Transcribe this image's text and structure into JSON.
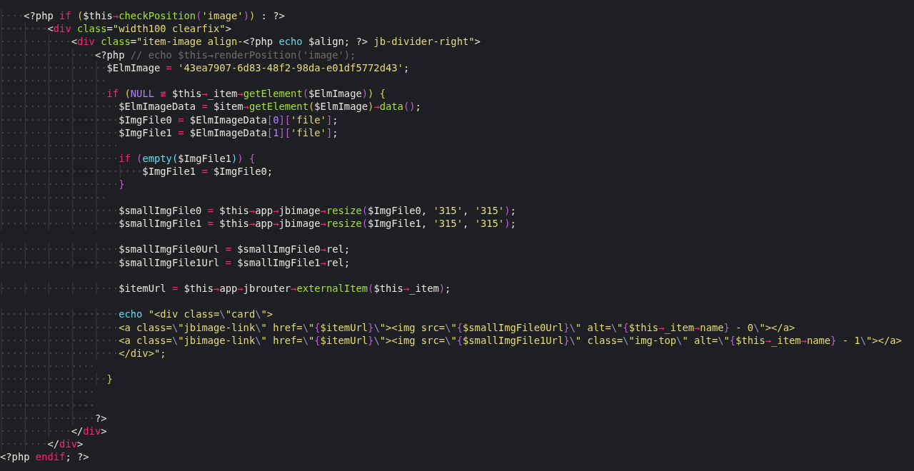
{
  "editor": {
    "lines": [
      {
        "indent": "····",
        "tokens": [
          {
            "kind": "plain",
            "text": "<?php "
          },
          {
            "kind": "kw",
            "text": "if "
          },
          {
            "kind": "b1",
            "text": "("
          },
          {
            "kind": "plain",
            "text": "$this"
          },
          {
            "kind": "kw",
            "text": "→"
          },
          {
            "kind": "fn",
            "text": "checkPosition"
          },
          {
            "kind": "b2",
            "text": "("
          },
          {
            "kind": "str",
            "text": "'image'"
          },
          {
            "kind": "b2",
            "text": ")"
          },
          {
            "kind": "b1",
            "text": ")"
          },
          {
            "kind": "plain",
            "text": " : ?>"
          }
        ]
      },
      {
        "indent": "········",
        "tokens": [
          {
            "kind": "plain",
            "text": "<"
          },
          {
            "kind": "kw",
            "text": "div"
          },
          {
            "kind": "fn",
            "text": " class"
          },
          {
            "kind": "plain",
            "text": "="
          },
          {
            "kind": "str",
            "text": "\"width100 clearfix\""
          },
          {
            "kind": "plain",
            "text": ">"
          }
        ]
      },
      {
        "indent": "············",
        "tokens": [
          {
            "kind": "plain",
            "text": "<"
          },
          {
            "kind": "kw",
            "text": "div"
          },
          {
            "kind": "fn",
            "text": " class"
          },
          {
            "kind": "plain",
            "text": "="
          },
          {
            "kind": "str",
            "text": "\"item-image align-"
          },
          {
            "kind": "plain",
            "text": "<?php "
          },
          {
            "kind": "builtin",
            "text": "echo"
          },
          {
            "kind": "plain",
            "text": " $align; ?>"
          },
          {
            "kind": "str",
            "text": " jb-divider-right\""
          },
          {
            "kind": "plain",
            "text": ">"
          }
        ]
      },
      {
        "indent": "················",
        "tokens": [
          {
            "kind": "plain",
            "text": "<?php "
          },
          {
            "kind": "comment",
            "text": "// echo $this→renderPosition('image');"
          }
        ]
      },
      {
        "indent": "··················",
        "tokens": [
          {
            "kind": "plain",
            "text": "$ElmImage"
          },
          {
            "kind": "kw",
            "text": " = "
          },
          {
            "kind": "str",
            "text": "'43ea7907-6d83-48f2-98da-e01df5772d43'"
          },
          {
            "kind": "plain",
            "text": ";"
          }
        ]
      },
      {
        "indent": "··················"
      },
      {
        "indent": "··················",
        "tokens": [
          {
            "kind": "kw",
            "text": "if "
          },
          {
            "kind": "b1",
            "text": "("
          },
          {
            "kind": "num",
            "text": "NULL"
          },
          {
            "kind": "kw",
            "text": " ≢ "
          },
          {
            "kind": "plain",
            "text": "$this"
          },
          {
            "kind": "kw",
            "text": "→"
          },
          {
            "kind": "plain",
            "text": "_item"
          },
          {
            "kind": "kw",
            "text": "→"
          },
          {
            "kind": "fn",
            "text": "getElement"
          },
          {
            "kind": "b2",
            "text": "("
          },
          {
            "kind": "plain",
            "text": "$ElmImage"
          },
          {
            "kind": "b2",
            "text": ")"
          },
          {
            "kind": "b1",
            "text": ") {"
          }
        ]
      },
      {
        "indent": "····················",
        "tokens": [
          {
            "kind": "plain",
            "text": "$ElmImageData"
          },
          {
            "kind": "kw",
            "text": " = "
          },
          {
            "kind": "plain",
            "text": "$item"
          },
          {
            "kind": "kw",
            "text": "→"
          },
          {
            "kind": "fn",
            "text": "getElement"
          },
          {
            "kind": "b1",
            "text": "("
          },
          {
            "kind": "plain",
            "text": "$ElmImage"
          },
          {
            "kind": "b1",
            "text": ")"
          },
          {
            "kind": "kw",
            "text": "→"
          },
          {
            "kind": "fn",
            "text": "data"
          },
          {
            "kind": "b2",
            "text": "()"
          },
          {
            "kind": "plain",
            "text": ";"
          }
        ]
      },
      {
        "indent": "····················",
        "tokens": [
          {
            "kind": "plain",
            "text": "$ImgFile0"
          },
          {
            "kind": "kw",
            "text": " = "
          },
          {
            "kind": "plain",
            "text": "$ElmImageData"
          },
          {
            "kind": "b2",
            "text": "["
          },
          {
            "kind": "num",
            "text": "0"
          },
          {
            "kind": "b2",
            "text": "]["
          },
          {
            "kind": "str",
            "text": "'file'"
          },
          {
            "kind": "b2",
            "text": "]"
          },
          {
            "kind": "plain",
            "text": ";"
          }
        ]
      },
      {
        "indent": "····················",
        "tokens": [
          {
            "kind": "plain",
            "text": "$ImgFile1"
          },
          {
            "kind": "kw",
            "text": " = "
          },
          {
            "kind": "plain",
            "text": "$ElmImageData"
          },
          {
            "kind": "b2",
            "text": "["
          },
          {
            "kind": "num",
            "text": "1"
          },
          {
            "kind": "b2",
            "text": "]["
          },
          {
            "kind": "str",
            "text": "'file'"
          },
          {
            "kind": "b2",
            "text": "]"
          },
          {
            "kind": "plain",
            "text": ";"
          }
        ]
      },
      {
        "indent": "····················"
      },
      {
        "indent": "····················",
        "tokens": [
          {
            "kind": "kw",
            "text": "if "
          },
          {
            "kind": "b2",
            "text": "("
          },
          {
            "kind": "builtin",
            "text": "empty"
          },
          {
            "kind": "builtin",
            "text": "("
          },
          {
            "kind": "plain",
            "text": "$ImgFile1"
          },
          {
            "kind": "builtin",
            "text": ")"
          },
          {
            "kind": "b2",
            "text": ") {"
          }
        ]
      },
      {
        "indent": "························",
        "tokens": [
          {
            "kind": "plain",
            "text": "$ImgFile1"
          },
          {
            "kind": "kw",
            "text": " = "
          },
          {
            "kind": "plain",
            "text": "$ImgFile0;"
          }
        ]
      },
      {
        "indent": "····················",
        "tokens": [
          {
            "kind": "b2",
            "text": "}"
          }
        ]
      },
      {
        "indent": "··················"
      },
      {
        "indent": "····················",
        "tokens": [
          {
            "kind": "plain",
            "text": "$smallImgFile0"
          },
          {
            "kind": "kw",
            "text": " = "
          },
          {
            "kind": "plain",
            "text": "$this"
          },
          {
            "kind": "kw",
            "text": "→"
          },
          {
            "kind": "plain",
            "text": "app"
          },
          {
            "kind": "kw",
            "text": "→"
          },
          {
            "kind": "plain",
            "text": "jbimage"
          },
          {
            "kind": "kw",
            "text": "→"
          },
          {
            "kind": "fn",
            "text": "resize"
          },
          {
            "kind": "b2",
            "text": "("
          },
          {
            "kind": "plain",
            "text": "$ImgFile0, "
          },
          {
            "kind": "str",
            "text": "'315'"
          },
          {
            "kind": "plain",
            "text": ", "
          },
          {
            "kind": "str",
            "text": "'315'"
          },
          {
            "kind": "b2",
            "text": ")"
          },
          {
            "kind": "plain",
            "text": ";"
          }
        ]
      },
      {
        "indent": "····················",
        "tokens": [
          {
            "kind": "plain",
            "text": "$smallImgFile1"
          },
          {
            "kind": "kw",
            "text": " = "
          },
          {
            "kind": "plain",
            "text": "$this"
          },
          {
            "kind": "kw",
            "text": "→"
          },
          {
            "kind": "plain",
            "text": "app"
          },
          {
            "kind": "kw",
            "text": "→"
          },
          {
            "kind": "plain",
            "text": "jbimage"
          },
          {
            "kind": "kw",
            "text": "→"
          },
          {
            "kind": "fn",
            "text": "resize"
          },
          {
            "kind": "b2",
            "text": "("
          },
          {
            "kind": "plain",
            "text": "$ImgFile1, "
          },
          {
            "kind": "str",
            "text": "'315'"
          },
          {
            "kind": "plain",
            "text": ", "
          },
          {
            "kind": "str",
            "text": "'315'"
          },
          {
            "kind": "b2",
            "text": ")"
          },
          {
            "kind": "plain",
            "text": ";"
          }
        ]
      },
      {
        "space_before": true,
        "indent": "····················",
        "tokens": [
          {
            "kind": "plain",
            "text": "$smallImgFile0Url"
          },
          {
            "kind": "kw",
            "text": " = "
          },
          {
            "kind": "plain",
            "text": "$smallImgFile0"
          },
          {
            "kind": "kw",
            "text": "→"
          },
          {
            "kind": "plain",
            "text": "rel;"
          }
        ]
      },
      {
        "indent": "····················",
        "tokens": [
          {
            "kind": "plain",
            "text": "$smallImgFile1Url"
          },
          {
            "kind": "kw",
            "text": " = "
          },
          {
            "kind": "plain",
            "text": "$smallImgFile1"
          },
          {
            "kind": "kw",
            "text": "→"
          },
          {
            "kind": "plain",
            "text": "rel;"
          }
        ]
      },
      {
        "space_before": true,
        "indent": "····················",
        "tokens": [
          {
            "kind": "plain",
            "text": "$itemUrl"
          },
          {
            "kind": "kw",
            "text": " = "
          },
          {
            "kind": "plain",
            "text": "$this"
          },
          {
            "kind": "kw",
            "text": "→"
          },
          {
            "kind": "plain",
            "text": "app"
          },
          {
            "kind": "kw",
            "text": "→"
          },
          {
            "kind": "plain",
            "text": "jbrouter"
          },
          {
            "kind": "kw",
            "text": "→"
          },
          {
            "kind": "fn",
            "text": "externalItem"
          },
          {
            "kind": "b2",
            "text": "("
          },
          {
            "kind": "plain",
            "text": "$this"
          },
          {
            "kind": "kw",
            "text": "→"
          },
          {
            "kind": "plain",
            "text": "_item"
          },
          {
            "kind": "b2",
            "text": ")"
          },
          {
            "kind": "plain",
            "text": ";"
          }
        ]
      },
      {
        "space_before": true,
        "indent": "····················",
        "tokens": [
          {
            "kind": "builtin",
            "text": "echo"
          },
          {
            "kind": "str",
            "text": " \"<div class="
          },
          {
            "kind": "esc",
            "text": "\\"
          },
          {
            "kind": "str",
            "text": "\"card"
          },
          {
            "kind": "esc",
            "text": "\\"
          },
          {
            "kind": "str",
            "text": "\">"
          }
        ]
      },
      {
        "indent": "····················",
        "tokens": [
          {
            "kind": "str",
            "text": "<a class="
          },
          {
            "kind": "esc",
            "text": "\\"
          },
          {
            "kind": "str",
            "text": "\"jbimage-link"
          },
          {
            "kind": "esc",
            "text": "\\"
          },
          {
            "kind": "str",
            "text": "\" href="
          },
          {
            "kind": "esc",
            "text": "\\"
          },
          {
            "kind": "str",
            "text": "\""
          },
          {
            "kind": "b2",
            "text": "{"
          },
          {
            "kind": "str",
            "text": "$itemUrl"
          },
          {
            "kind": "b2",
            "text": "}"
          },
          {
            "kind": "esc",
            "text": "\\"
          },
          {
            "kind": "str",
            "text": "\"><img src="
          },
          {
            "kind": "esc",
            "text": "\\"
          },
          {
            "kind": "str",
            "text": "\""
          },
          {
            "kind": "b2",
            "text": "{"
          },
          {
            "kind": "str",
            "text": "$smallImgFile0Url"
          },
          {
            "kind": "b2",
            "text": "}"
          },
          {
            "kind": "esc",
            "text": "\\"
          },
          {
            "kind": "str",
            "text": "\" alt="
          },
          {
            "kind": "esc",
            "text": "\\"
          },
          {
            "kind": "str",
            "text": "\""
          },
          {
            "kind": "b2",
            "text": "{"
          },
          {
            "kind": "str",
            "text": "$this"
          },
          {
            "kind": "kw",
            "text": "→"
          },
          {
            "kind": "str",
            "text": "_item"
          },
          {
            "kind": "kw",
            "text": "→"
          },
          {
            "kind": "str",
            "text": "name"
          },
          {
            "kind": "b2",
            "text": "}"
          },
          {
            "kind": "str",
            "text": " - 0"
          },
          {
            "kind": "esc",
            "text": "\\"
          },
          {
            "kind": "str",
            "text": "\"></a>"
          }
        ]
      },
      {
        "indent": "····················",
        "tokens": [
          {
            "kind": "str",
            "text": "<a class="
          },
          {
            "kind": "esc",
            "text": "\\"
          },
          {
            "kind": "str",
            "text": "\"jbimage-link"
          },
          {
            "kind": "esc",
            "text": "\\"
          },
          {
            "kind": "str",
            "text": "\" href="
          },
          {
            "kind": "esc",
            "text": "\\"
          },
          {
            "kind": "str",
            "text": "\""
          },
          {
            "kind": "b2",
            "text": "{"
          },
          {
            "kind": "str",
            "text": "$itemUrl"
          },
          {
            "kind": "b2",
            "text": "}"
          },
          {
            "kind": "esc",
            "text": "\\"
          },
          {
            "kind": "str",
            "text": "\"><img src="
          },
          {
            "kind": "esc",
            "text": "\\"
          },
          {
            "kind": "str",
            "text": "\""
          },
          {
            "kind": "b2",
            "text": "{"
          },
          {
            "kind": "str",
            "text": "$smallImgFile1Url"
          },
          {
            "kind": "b2",
            "text": "}"
          },
          {
            "kind": "esc",
            "text": "\\"
          },
          {
            "kind": "str",
            "text": "\" class="
          },
          {
            "kind": "esc",
            "text": "\\"
          },
          {
            "kind": "str",
            "text": "\"img-top"
          },
          {
            "kind": "esc",
            "text": "\\"
          },
          {
            "kind": "str",
            "text": "\" alt="
          },
          {
            "kind": "esc",
            "text": "\\"
          },
          {
            "kind": "str",
            "text": "\""
          },
          {
            "kind": "b2",
            "text": "{"
          },
          {
            "kind": "str",
            "text": "$this"
          },
          {
            "kind": "kw",
            "text": "→"
          },
          {
            "kind": "str",
            "text": "_item"
          },
          {
            "kind": "kw",
            "text": "→"
          },
          {
            "kind": "str",
            "text": "name"
          },
          {
            "kind": "b2",
            "text": "}"
          },
          {
            "kind": "str",
            "text": " - 1"
          },
          {
            "kind": "esc",
            "text": "\\"
          },
          {
            "kind": "str",
            "text": "\"></a>"
          }
        ]
      },
      {
        "indent": "····················",
        "tokens": [
          {
            "kind": "str",
            "text": "</div>\";"
          }
        ]
      },
      {
        "indent": "················"
      },
      {
        "indent": "··················",
        "tokens": [
          {
            "kind": "b1",
            "text": "}"
          }
        ]
      },
      {
        "indent": "················"
      },
      {
        "indent": "················"
      },
      {
        "indent": "················",
        "tokens": [
          {
            "kind": "plain",
            "text": "?>"
          }
        ]
      },
      {
        "indent": "············",
        "tokens": [
          {
            "kind": "plain",
            "text": "</"
          },
          {
            "kind": "kw",
            "text": "div"
          },
          {
            "kind": "plain",
            "text": ">"
          }
        ]
      },
      {
        "indent": "········",
        "tokens": [
          {
            "kind": "plain",
            "text": "</"
          },
          {
            "kind": "kw",
            "text": "div"
          },
          {
            "kind": "plain",
            "text": ">"
          }
        ]
      },
      {
        "tokens": [
          {
            "kind": "plain",
            "text": "<?php "
          },
          {
            "kind": "kw",
            "text": "endif"
          },
          {
            "kind": "plain",
            "text": "; ?>"
          }
        ]
      }
    ]
  }
}
